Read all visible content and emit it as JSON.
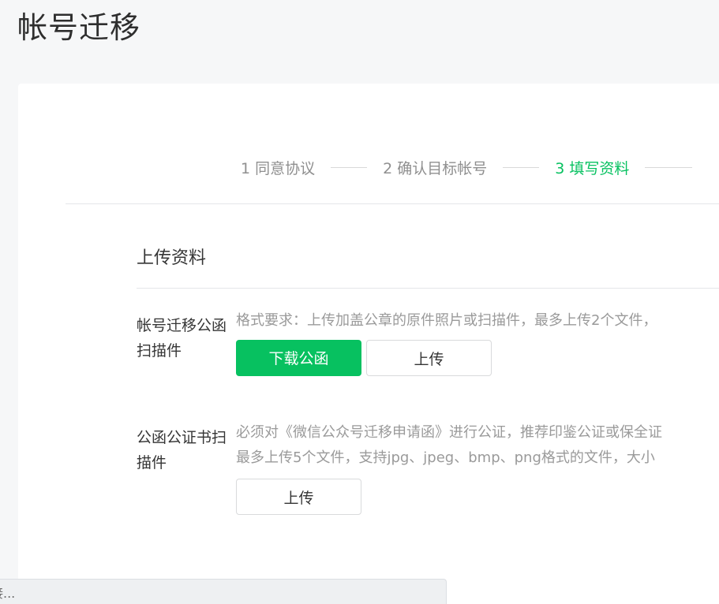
{
  "page": {
    "title": "帐号迁移"
  },
  "steps": [
    {
      "label": "1 同意协议",
      "active": false
    },
    {
      "label": "2 确认目标帐号",
      "active": false
    },
    {
      "label": "3 填写资料",
      "active": true
    }
  ],
  "section": {
    "title": "上传资料"
  },
  "fields": [
    {
      "label": "帐号迁移公函扫描件",
      "tip_lines": [
        "格式要求：上传加盖公章的原件照片或扫描件，最多上传2个文件，"
      ],
      "download_label": "下载公函",
      "upload_label": "上传"
    },
    {
      "label": "公函公证书扫描件",
      "tip_lines": [
        "必须对《微信公众号迁移申请函》进行公证，推荐印鉴公证或保全证",
        "最多上传5个文件，支持jpg、jpeg、bmp、png格式的文件，大小"
      ],
      "upload_label": "上传"
    }
  ],
  "status_bar": {
    "text": "接..."
  },
  "colors": {
    "accent": "#07c160",
    "background": "#f6f7f8",
    "card": "#ffffff",
    "muted_text": "#9a9a9a"
  }
}
